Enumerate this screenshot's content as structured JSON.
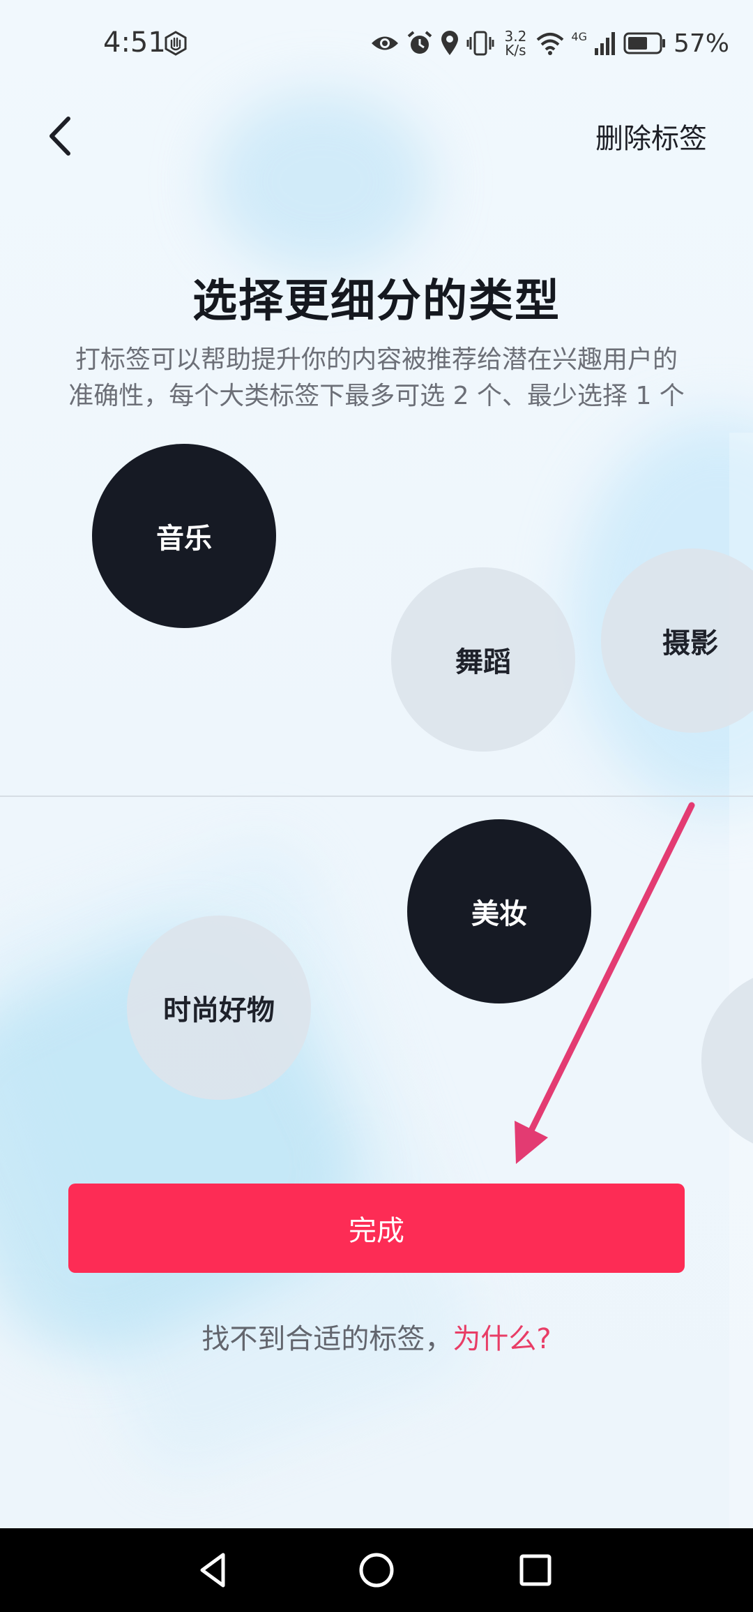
{
  "status_bar": {
    "time": "4:51",
    "net_speed_value": "3.2",
    "net_speed_unit": "K/s",
    "network_type": "4G",
    "battery": "57%",
    "icons": [
      "hand-stop-icon",
      "eye-icon",
      "alarm-icon",
      "location-icon",
      "vibrate-icon",
      "wifi-icon",
      "signal-icon",
      "battery-icon"
    ]
  },
  "header": {
    "back_icon": "chevron-left-icon",
    "delete_label": "删除标签"
  },
  "title": "选择更细分的类型",
  "description_lines": [
    "打标签可以帮助提升你的内容被推荐给潜在兴趣用户的",
    "准确性，每个大类标签下最多可选 2 个、最少选择 1 个"
  ],
  "tags": [
    {
      "label": "音乐",
      "selected": true
    },
    {
      "label": "舞蹈",
      "selected": false
    },
    {
      "label": "摄影",
      "selected": false
    },
    {
      "label": "美妆",
      "selected": true
    },
    {
      "label": "时尚好物",
      "selected": false
    },
    {
      "label": "",
      "selected": false
    }
  ],
  "done_button": "完成",
  "help": {
    "text": "找不到合适的标签，",
    "link": "为什么?"
  },
  "colors": {
    "accent": "#fd2c55",
    "selected_tag": "#161a24",
    "unselected_tag": "#dde4eb",
    "link": "#e83d66",
    "annotation_arrow": "#e33b72"
  },
  "nav_bar": {
    "icons": [
      "triangle-back-icon",
      "circle-home-icon",
      "square-recents-icon"
    ]
  }
}
